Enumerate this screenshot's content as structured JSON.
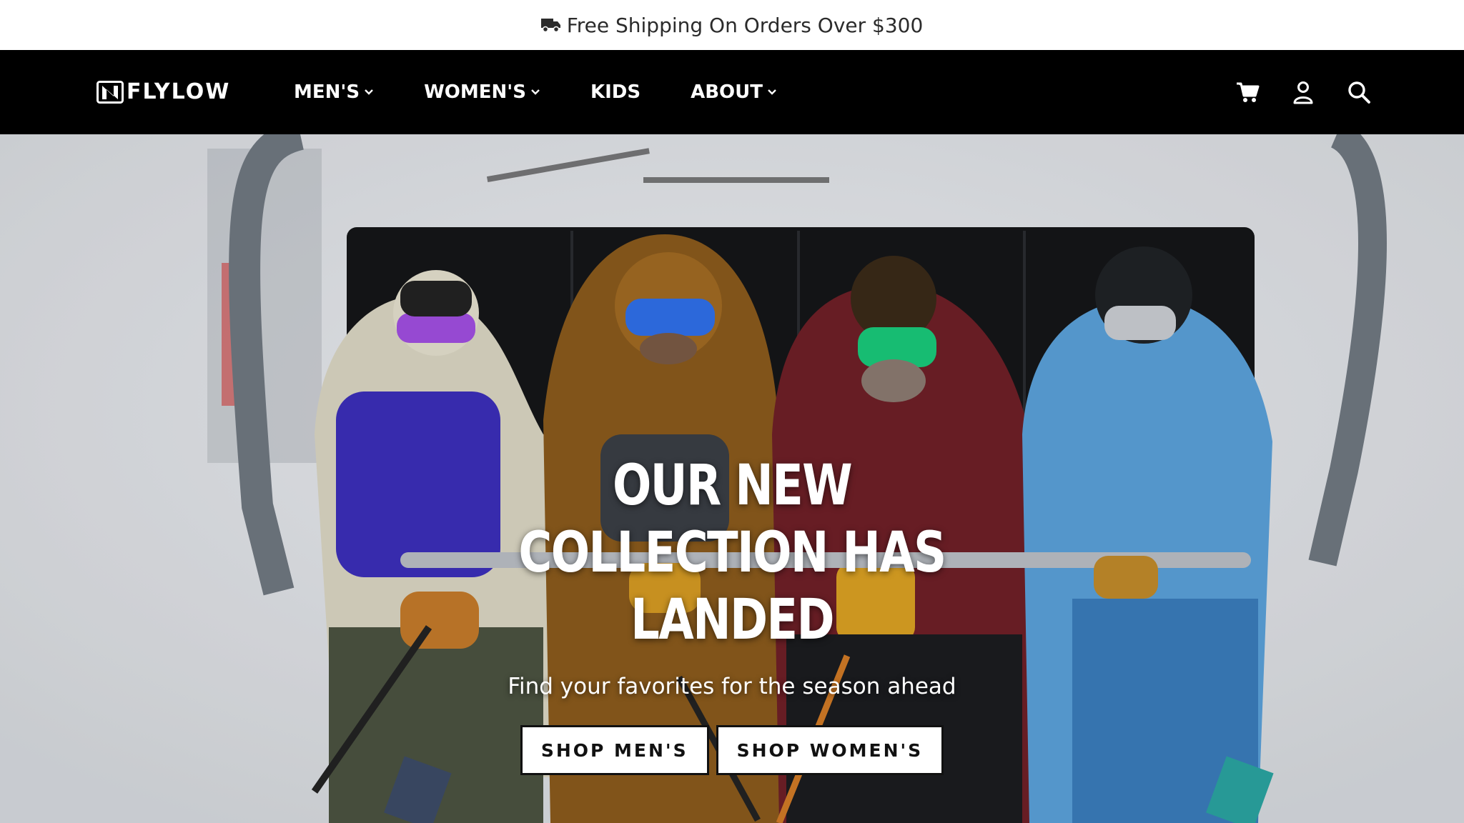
{
  "announcement": {
    "icon": "truck-icon",
    "text": "Free Shipping On Orders Over $300"
  },
  "header": {
    "logo_text": "FLYLOW",
    "nav": [
      {
        "label": "MEN'S",
        "has_dropdown": true
      },
      {
        "label": "WOMEN'S",
        "has_dropdown": true
      },
      {
        "label": "KIDS",
        "has_dropdown": false
      },
      {
        "label": "ABOUT",
        "has_dropdown": true
      }
    ],
    "icons": [
      "cart-icon",
      "account-icon",
      "search-icon"
    ]
  },
  "hero": {
    "title": "OUR NEW COLLECTION HAS LANDED",
    "subtitle": "Find your favorites for the season ahead",
    "buttons": {
      "shop_mens": "SHOP MEN'S",
      "shop_womens": "SHOP WOMEN'S"
    }
  },
  "colors": {
    "header_bg": "#000000",
    "announcement_bg": "#ffffff",
    "button_bg": "#ffffff",
    "button_text": "#111111"
  }
}
